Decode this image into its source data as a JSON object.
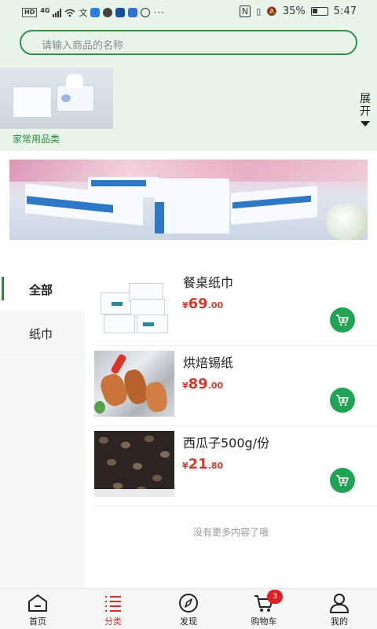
{
  "status_bar": {
    "net_label": "HD",
    "net_type": "4G",
    "battery": "35%",
    "time": "5:47"
  },
  "search": {
    "placeholder": "请输入商品的名称"
  },
  "category_strip": {
    "items": [
      {
        "label": "家常用品类"
      }
    ],
    "expand_label": "展开"
  },
  "sidebar": {
    "items": [
      {
        "label": "全部",
        "active": true
      },
      {
        "label": "纸巾",
        "active": false
      }
    ]
  },
  "products": [
    {
      "name": "餐桌纸巾",
      "price_symbol": "¥",
      "price_int": "69",
      "price_dec": ".00"
    },
    {
      "name": "烘焙锡纸",
      "price_symbol": "¥",
      "price_int": "89",
      "price_dec": ".00"
    },
    {
      "name": "西瓜子500g/份",
      "price_symbol": "¥",
      "price_int": "21",
      "price_dec": ".80"
    }
  ],
  "list_end_text": "没有更多内容了哦",
  "tabbar": {
    "tabs": [
      {
        "label": "首页",
        "icon": "home-icon"
      },
      {
        "label": "分类",
        "icon": "category-list-icon",
        "active": true
      },
      {
        "label": "发现",
        "icon": "compass-icon"
      },
      {
        "label": "购物车",
        "icon": "cart-icon",
        "badge": "3"
      },
      {
        "label": "我的",
        "icon": "user-icon"
      }
    ]
  },
  "colors": {
    "accent_green": "#21a355",
    "header_bg": "#e8f5ea",
    "price_red": "#d43b2f",
    "active_tab_red": "#c8342a",
    "badge_red": "#e02020"
  }
}
